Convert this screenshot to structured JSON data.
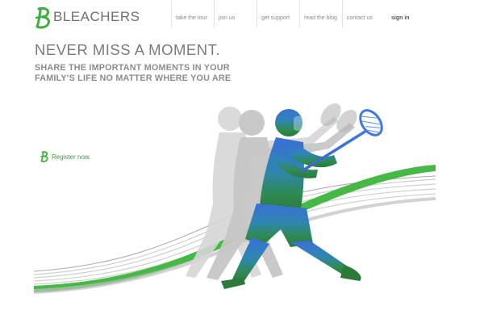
{
  "brand": {
    "name": "BLEACHERS",
    "accent": "#3fae3f"
  },
  "nav": {
    "items": [
      {
        "label": "take the tour"
      },
      {
        "label": "join us"
      },
      {
        "label": "get support"
      },
      {
        "label": "read the blog"
      },
      {
        "label": "contact us"
      }
    ],
    "signin_label": "sign in"
  },
  "hero": {
    "headline": "NEVER MISS A MOMENT.",
    "subhead_line1": "SHARE THE IMPORTANT MOMENTS IN YOUR",
    "subhead_line2": "FAMILY'S LIFE NO MATTER WHERE YOU ARE",
    "register_label": "Register now."
  },
  "icons": {
    "logo": "bleachers-b-logo-icon",
    "register": "bleachers-b-small-icon",
    "illustration": "lacrosse-player-illustration"
  }
}
